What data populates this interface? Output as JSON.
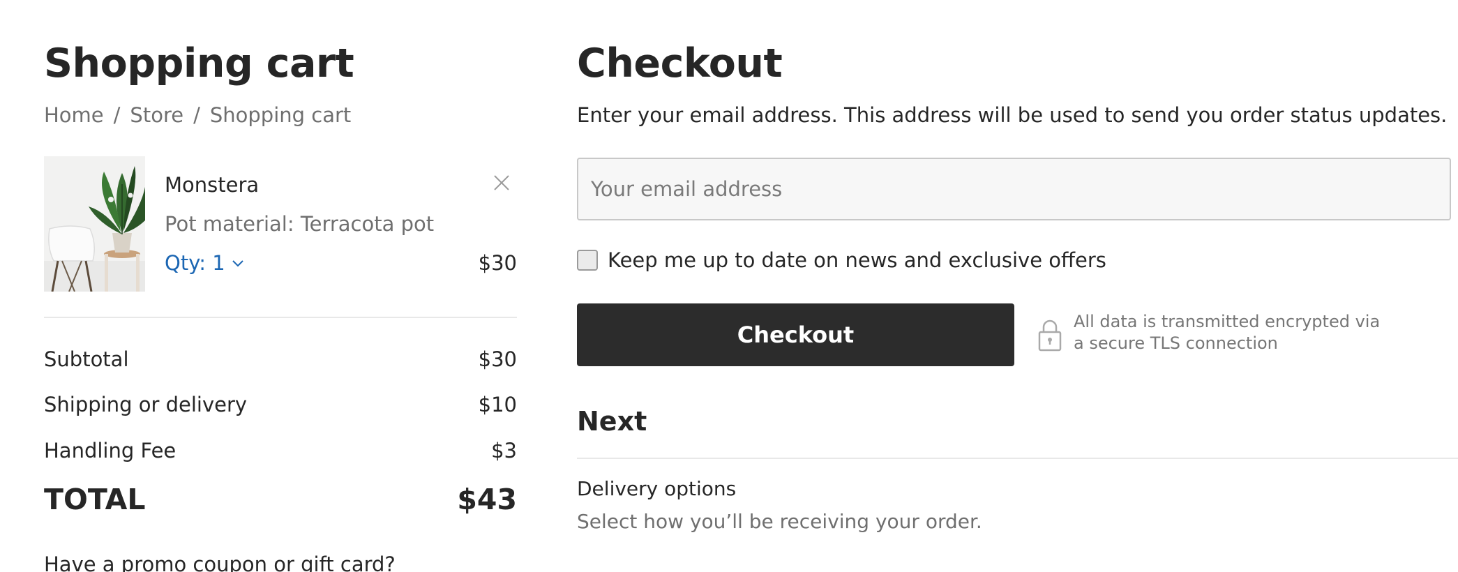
{
  "cart": {
    "title": "Shopping cart",
    "breadcrumb": [
      "Home",
      "Store",
      "Shopping cart"
    ],
    "breadcrumb_separator": "/",
    "item": {
      "name": "Monstera",
      "option": "Pot material: Terracota pot",
      "qty_label": "Qty: 1",
      "price": "$30",
      "image_icon": "monstera-plant-photo"
    },
    "summary": {
      "subtotal_label": "Subtotal",
      "subtotal_value": "$30",
      "shipping_label": "Shipping or delivery",
      "shipping_value": "$10",
      "handling_label": "Handling Fee",
      "handling_value": "$3",
      "total_label": "TOTAL",
      "total_value": "$43"
    },
    "promo_link": "Have a promo coupon or gift card?"
  },
  "checkout": {
    "title": "Checkout",
    "description": "Enter your email address. This address will be used to send you order status updates.",
    "email_placeholder": "Your email address",
    "email_value": "",
    "newsletter_label": "Keep me up to date on news and exclusive offers",
    "newsletter_checked": false,
    "button_label": "Checkout",
    "secure_line1": "All data is transmitted encrypted via",
    "secure_line2": "a secure TLS connection",
    "next_title": "Next",
    "delivery_title": "Delivery options",
    "delivery_desc": "Select how you’ll be receiving your order."
  },
  "colors": {
    "text": "#262626",
    "muted": "#6f6f6f",
    "link": "#1b66b3",
    "button_bg": "#2c2c2c",
    "divider": "#e8e8e8"
  }
}
